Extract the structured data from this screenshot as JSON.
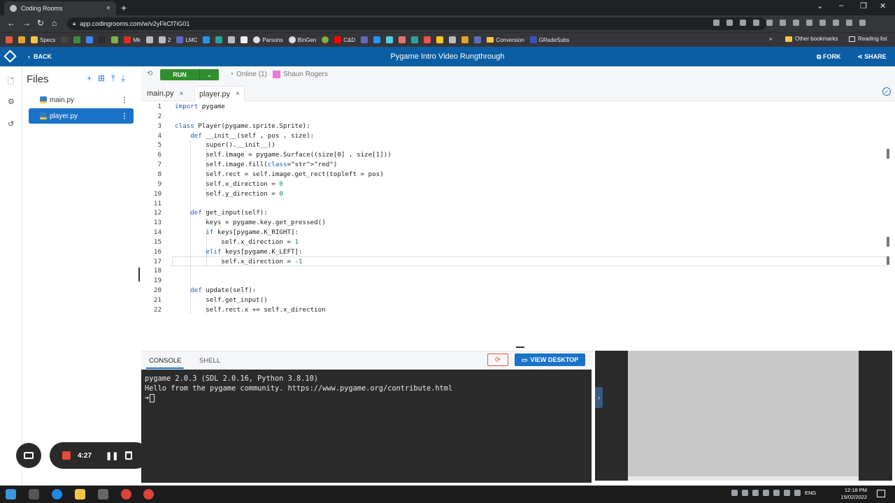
{
  "browser": {
    "tab_title": "Coding Rooms",
    "url": "app.codingrooms.com/w/v2yFkCf7iG01",
    "bookmarks": [
      "Specs",
      "Mk",
      "2",
      "LMC",
      "Parsons",
      "BinGen",
      "C&D",
      "Conversion",
      "GRadeSubs"
    ],
    "other_bookmarks": "Other bookmarks",
    "reading_list": "Reading list"
  },
  "header": {
    "back_label": "BACK",
    "title": "Pygame Intro Video Rungthrough",
    "fork_label": "FORK",
    "share_label": "SHARE"
  },
  "files": {
    "title": "Files",
    "items": [
      {
        "name": "main.py",
        "selected": false
      },
      {
        "name": "player.py",
        "selected": true
      }
    ]
  },
  "toolbar": {
    "run_label": "RUN",
    "online_label": "Online (1)",
    "user_name": "Shaun Rogers"
  },
  "editor": {
    "tabs": [
      {
        "name": "main.py",
        "active": false
      },
      {
        "name": "player.py",
        "active": true
      }
    ],
    "lines": [
      "import pygame",
      "",
      "class Player(pygame.sprite.Sprite):",
      "    def __init__(self , pos , size):",
      "        super().__init__()",
      "        self.image = pygame.Surface((size[0] , size[1]))",
      "        self.image.fill(\"red\")",
      "        self.rect = self.image.get_rect(topleft = pos)",
      "        self.x_direction = 0",
      "        self.y_direction = 0",
      "",
      "    def get_input(self):",
      "        keys = pygame.key.get_pressed()",
      "        if keys[pygame.K_RIGHT]:",
      "            self.x_direction = 1",
      "        elif keys[pygame.K_LEFT]:",
      "            self.x_direction = -1",
      "",
      "",
      "    def update(self):",
      "        self.get_input()",
      "        self.rect.x += self.x_direction"
    ],
    "current_line": 17
  },
  "console": {
    "tabs": [
      "CONSOLE",
      "SHELL"
    ],
    "view_desktop_label": "VIEW DESKTOP",
    "lines": [
      "pygame 2.0.3 (SDL 2.0.16, Python 3.8.10)",
      "Hello from the pygame community. https://www.pygame.org/contribute.html"
    ],
    "prompt": "➜"
  },
  "recorder": {
    "elapsed": "4:27"
  },
  "taskbar": {
    "language": "ENG",
    "time": "12:18 PM",
    "date": "15/02/2022"
  },
  "colors": {
    "header_bg": "#0b5ea3",
    "run_green": "#2f8f2f",
    "selected_file": "#1a73c8",
    "console_bg": "#2b2b2b"
  }
}
